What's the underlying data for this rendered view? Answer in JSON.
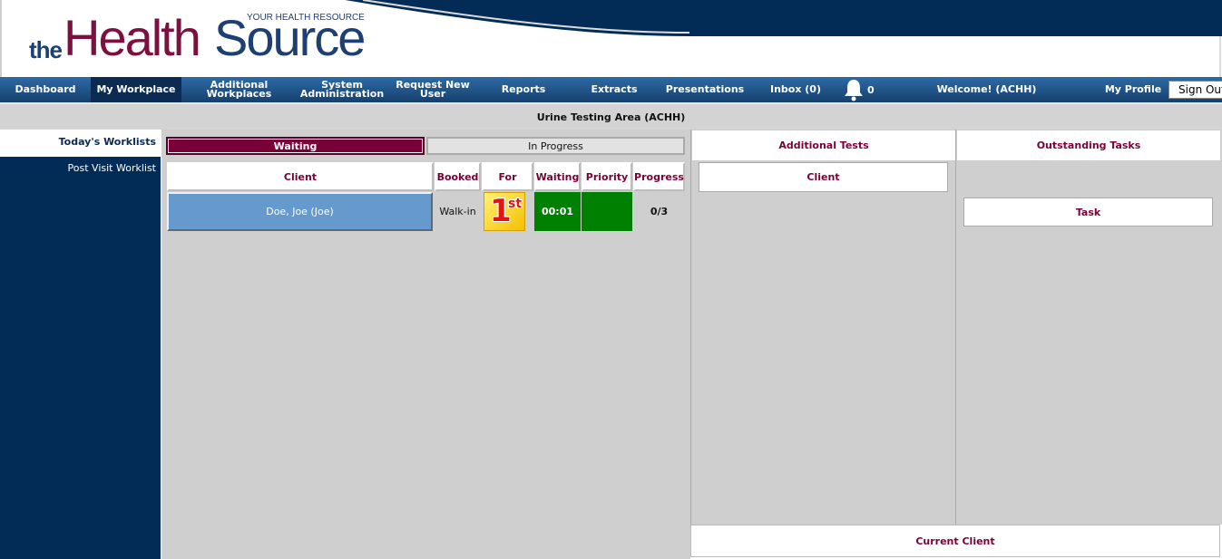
{
  "brand": {
    "the": "the",
    "health": "Health",
    "source": "Source",
    "tagline": "YOUR HEALTH RESOURCE"
  },
  "nav": {
    "items": [
      {
        "label": "Dashboard",
        "active": false
      },
      {
        "label": "My Workplace",
        "active": true
      },
      {
        "label": "Additional Workplaces",
        "active": false
      },
      {
        "label": "System Administration",
        "active": false
      },
      {
        "label": "Request New User",
        "active": false
      },
      {
        "label": "Reports",
        "active": false
      },
      {
        "label": "Extracts",
        "active": false
      },
      {
        "label": "Presentations",
        "active": false
      },
      {
        "label": "Inbox (0)",
        "active": false
      }
    ],
    "notification_count": "0",
    "welcome": "Welcome! (ACHH)",
    "profile": "My Profile",
    "signout": "Sign Out"
  },
  "area": {
    "title": "Urine Testing Area (ACHH)"
  },
  "sidebar": {
    "items": [
      {
        "label": "Today's Worklists",
        "selected": true
      },
      {
        "label": "Post Visit Worklist",
        "selected": false
      }
    ]
  },
  "worklist": {
    "tabs": [
      {
        "label": "Waiting",
        "active": true
      },
      {
        "label": "In Progress",
        "active": false
      }
    ],
    "columns": [
      "Client",
      "Booked",
      "For",
      "Waiting",
      "Priority",
      "Progress"
    ],
    "rows": [
      {
        "client": "Doe, Joe (Joe)",
        "booked": "Walk-in",
        "for_badge": {
          "number": "1",
          "suffix": "st"
        },
        "waiting": "00:01",
        "priority_color": "#008000",
        "progress": "0/3"
      }
    ]
  },
  "additional_tests": {
    "title": "Additional Tests",
    "client_header": "Client"
  },
  "outstanding_tasks": {
    "title": "Outstanding Tasks",
    "task_header": "Task"
  },
  "current_client": {
    "title": "Current Client"
  },
  "colors": {
    "brand_maroon": "#7a0038",
    "brand_navy": "#022c55",
    "nav_blue": "#2d6ba6",
    "client_row": "#6699cc",
    "status_green": "#008000"
  }
}
